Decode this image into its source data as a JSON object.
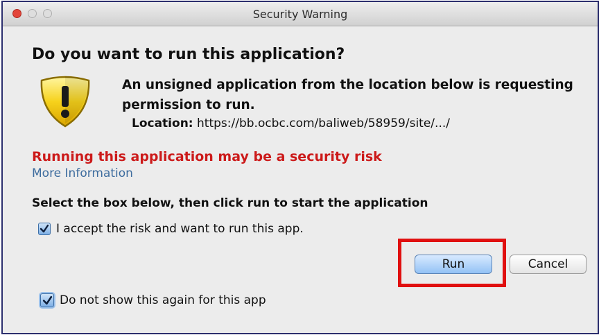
{
  "window": {
    "title": "Security Warning"
  },
  "dialog": {
    "heading": "Do you want to run this application?",
    "message": "An unsigned application from the location below is requesting permission to run.",
    "location_label": "Location:",
    "location_value": "https://bb.ocbc.com/baliweb/58959/site/.../",
    "risk_warning": "Running this application may be a security risk",
    "more_info": "More Information",
    "instruction": "Select the box below, then click run to start the application",
    "accept_checkbox": {
      "label": "I accept the risk and want to run this app.",
      "checked": true
    },
    "dont_show_checkbox": {
      "label": "Do not show this again for this app",
      "checked": true
    },
    "buttons": {
      "run": "Run",
      "cancel": "Cancel"
    }
  },
  "icons": {
    "warning": "shield-warning-icon",
    "check": "checkmark-icon"
  },
  "colors": {
    "risk_text": "#cc1a1a",
    "link": "#3d6c9e",
    "highlight_box": "#e01010",
    "default_button": "#93c2f5"
  }
}
